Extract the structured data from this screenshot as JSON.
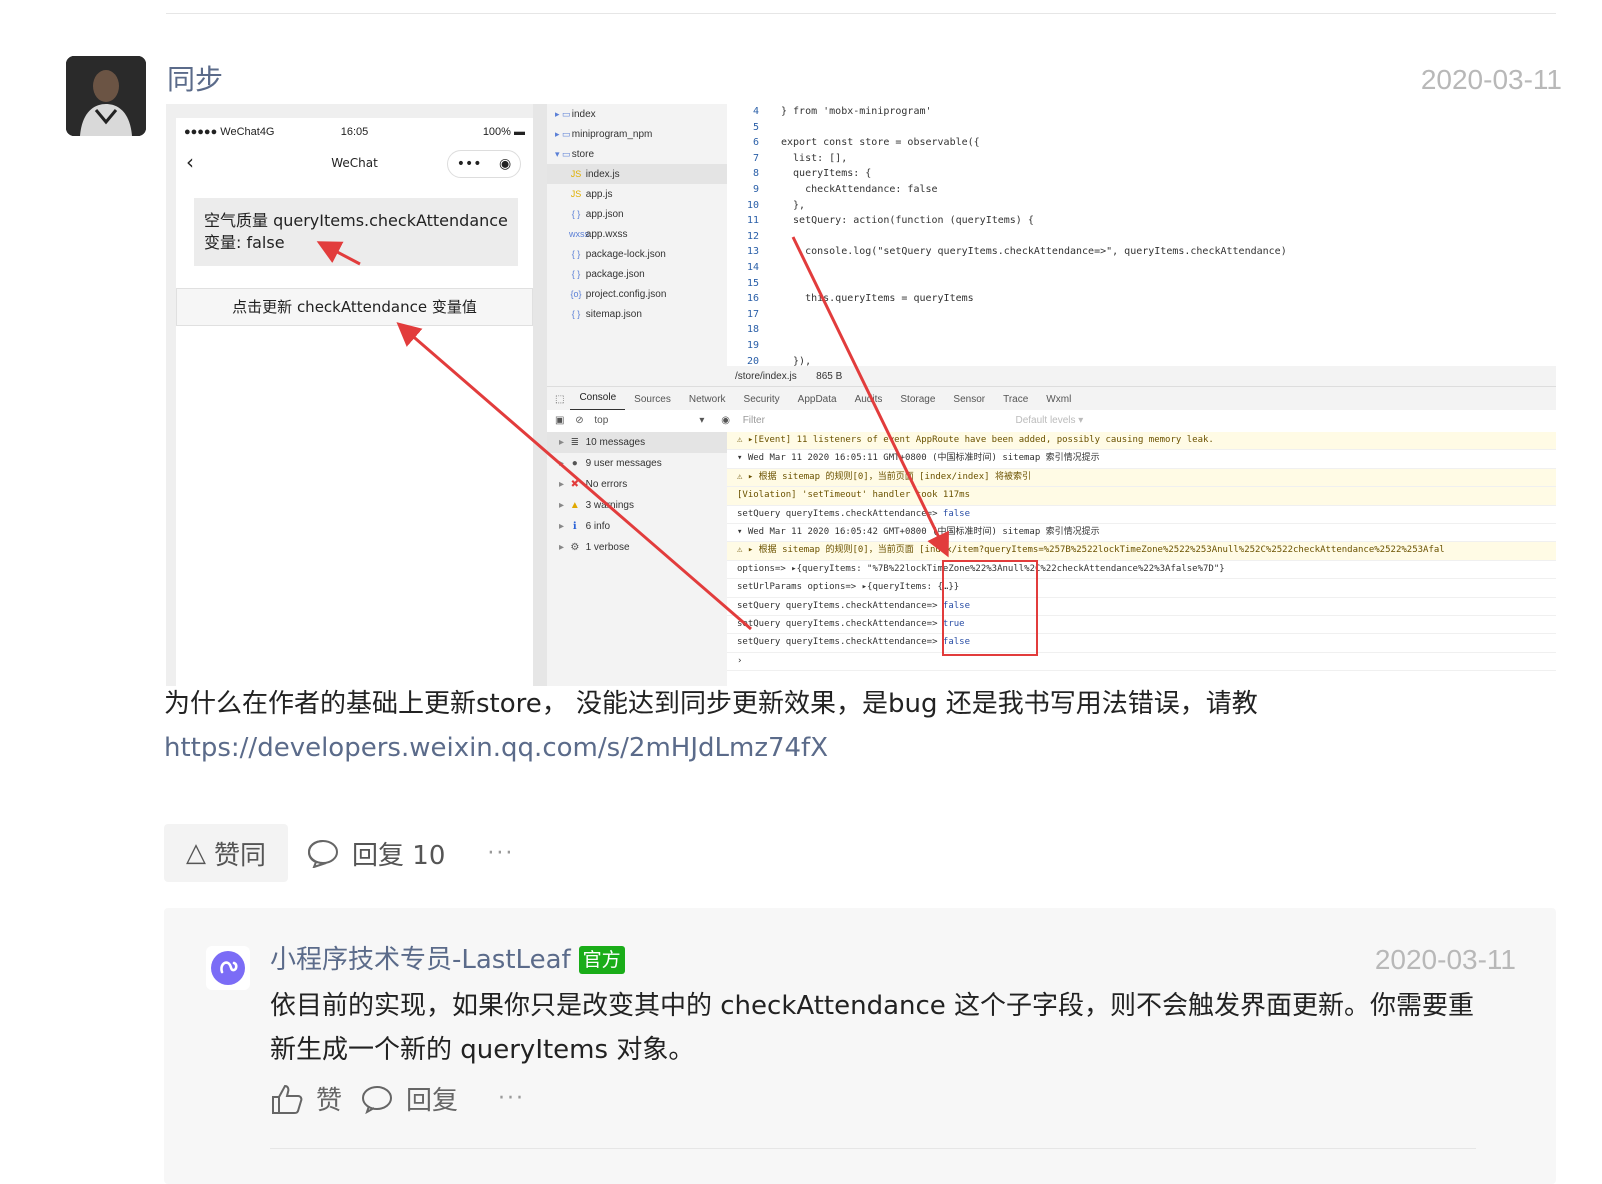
{
  "post": {
    "author": "同步",
    "date": "2020-03-11",
    "body": "为什么在作者的基础上更新store， 没能达到同步更新效果，是bug 还是我书写用法错误，请教",
    "link": "https://developers.weixin.qq.com/s/2mHJdLmz74fX",
    "like_label": "赞同",
    "reply_label": "回复 10",
    "more_label": "···"
  },
  "screenshot": {
    "phone": {
      "carrier": "●●●●● WeChat4G",
      "time": "16:05",
      "battery": "100%",
      "nav_title": "WeChat",
      "state_line1": "空气质量 queryItems.checkAttendance",
      "state_line2": "变量:   false",
      "update_button": "点击更新 checkAttendance 变量值"
    },
    "filetree": [
      {
        "icon": "▸ ▭",
        "name": "index"
      },
      {
        "icon": "▸ ▭",
        "name": "miniprogram_npm"
      },
      {
        "icon": "▾ ▭",
        "name": "store"
      },
      {
        "icon": "JS",
        "name": "index.js"
      },
      {
        "icon": "JS",
        "name": "app.js"
      },
      {
        "icon": "{ }",
        "name": "app.json"
      },
      {
        "icon": "wxss",
        "name": "app.wxss"
      },
      {
        "icon": "{ }",
        "name": "package-lock.json"
      },
      {
        "icon": "{ }",
        "name": "package.json"
      },
      {
        "icon": "{o}",
        "name": "project.config.json"
      },
      {
        "icon": "{ }",
        "name": "sitemap.json"
      }
    ],
    "code": [
      {
        "n": "4",
        "t": "} from 'mobx-miniprogram'"
      },
      {
        "n": "5",
        "t": ""
      },
      {
        "n": "6",
        "t": "export const store = observable({"
      },
      {
        "n": "7",
        "t": "  list: [],"
      },
      {
        "n": "8",
        "t": "  queryItems: {"
      },
      {
        "n": "9",
        "t": "    checkAttendance: false"
      },
      {
        "n": "10",
        "t": "  },"
      },
      {
        "n": "11",
        "t": "  setQuery: action(function (queryItems) {"
      },
      {
        "n": "12",
        "t": ""
      },
      {
        "n": "13",
        "t": "    console.log(\"setQuery queryItems.checkAttendance=>\", queryItems.checkAttendance)"
      },
      {
        "n": "14",
        "t": ""
      },
      {
        "n": "15",
        "t": ""
      },
      {
        "n": "16",
        "t": "    this.queryItems = queryItems"
      },
      {
        "n": "17",
        "t": ""
      },
      {
        "n": "18",
        "t": ""
      },
      {
        "n": "19",
        "t": ""
      },
      {
        "n": "20",
        "t": "  }),"
      }
    ],
    "editor_status": {
      "path": "/store/index.js",
      "size": "865 B"
    },
    "devtabs": [
      "Console",
      "Sources",
      "Network",
      "Security",
      "AppData",
      "Audits",
      "Storage",
      "Sensor",
      "Trace",
      "Wxml"
    ],
    "filter": {
      "context": "top",
      "placeholder": "Filter",
      "levels": "Default levels ▾"
    },
    "sidebar": [
      {
        "icon": "≣",
        "label": "10 messages"
      },
      {
        "icon": "●",
        "label": "9 user messages"
      },
      {
        "icon": "✖",
        "label": "No errors"
      },
      {
        "icon": "▲",
        "label": "3 warnings"
      },
      {
        "icon": "ℹ",
        "label": "6 info"
      },
      {
        "icon": "⚙",
        "label": "1 verbose"
      }
    ],
    "console": [
      {
        "kind": "warn",
        "text": "⚠ ▸[Event] 11 listeners of event AppRoute have been added, possibly causing memory leak."
      },
      {
        "kind": "",
        "text": "▾ Wed Mar 11 2020 16:05:11 GMT+0800 (中国标准时间) sitemap 索引情况提示"
      },
      {
        "kind": "warn",
        "text": "⚠ ▸ 根据 sitemap 的规则[0]，当前页面 [index/index] 将被索引"
      },
      {
        "kind": "warn",
        "text": "[Violation] 'setTimeout' handler took 117ms"
      },
      {
        "kind": "",
        "text": "setQuery queryItems.checkAttendance=> false"
      },
      {
        "kind": "",
        "text": "▾ Wed Mar 11 2020 16:05:42 GMT+0800 (中国标准时间) sitemap 索引情况提示"
      },
      {
        "kind": "warn",
        "text": "⚠ ▸ 根据 sitemap 的规则[0]，当前页面 [index/item?queryItems=%257B%2522lockTimeZone%2522%253Anull%252C%2522checkAttendance%2522%253Afal"
      },
      {
        "kind": "",
        "text": "options=> ▸{queryItems: \"%7B%22lockTimeZone%22%3Anull%2C%22checkAttendance%22%3Afalse%7D\"}"
      },
      {
        "kind": "",
        "text": "setUrlParams options=> ▸{queryItems: {…}}"
      },
      {
        "kind": "",
        "text": "setQuery queryItems.checkAttendance=> false"
      },
      {
        "kind": "",
        "text": "setQuery queryItems.checkAttendance=> true"
      },
      {
        "kind": "",
        "text": "setQuery queryItems.checkAttendance=> false"
      },
      {
        "kind": "",
        "text": "›"
      }
    ]
  },
  "reply": {
    "author": "小程序技术专员-LastLeaf",
    "badge": "官方",
    "date": "2020-03-11",
    "body": "依目前的实现，如果你只是改变其中的 checkAttendance 这个子字段，则不会触发界面更新。你需要重新生成一个新的 queryItems 对象。",
    "like_label": "赞",
    "reply_label": "回复",
    "more_label": "···"
  },
  "colors": {
    "link": "#5b6b8a",
    "muted_date": "#b8b8b8",
    "official_badge": "#1aad19",
    "annotation_red": "#e23c3c"
  }
}
